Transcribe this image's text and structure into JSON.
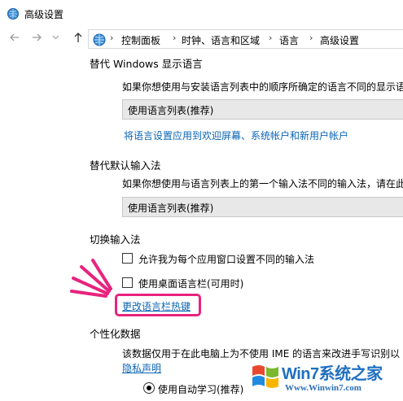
{
  "window": {
    "title": "高级设置"
  },
  "nav": {
    "back_icon": "arrow-left-icon",
    "forward_icon": "arrow-right-icon",
    "recent_icon": "chevron-down-icon",
    "up_icon": "arrow-up-icon"
  },
  "breadcrumb": [
    "控制面板",
    "时钟、语言和区域",
    "语言",
    "高级设置"
  ],
  "sections": {
    "override_display": {
      "title": "替代 Windows 显示语言",
      "description": "如果你想使用与安装语言列表中的顺序所确定的语言不同的显示语",
      "select_value": "使用语言列表(推荐)",
      "link": "将语言设置应用到欢迎屏幕、系统帐户和新用户帐户"
    },
    "override_input": {
      "title": "替代默认输入法",
      "description": "如果你想使用与语言列表上的第一个输入法不同的输入法，请在此",
      "select_value": "使用语言列表(推荐)"
    },
    "switch_input": {
      "title": "切换输入法",
      "checkbox1": "允许我为每个应用窗口设置不同的输入法",
      "checkbox2": "使用桌面语言栏(可用时)",
      "link": "更改语言栏热键"
    },
    "personalization": {
      "title": "个性化数据",
      "description": "该数据仅用于在此电脑上为不使用 IME 的语言来改进手写识别以",
      "link": "隐私声明",
      "radio": "使用自动学习(推荐)"
    }
  },
  "watermark": {
    "brand": "Win7系统之家",
    "url": "Www.Winwin7.com"
  },
  "colors": {
    "link": "#0a64b4",
    "highlight": "#e8237e",
    "select_bg": "#e8e8e8"
  }
}
